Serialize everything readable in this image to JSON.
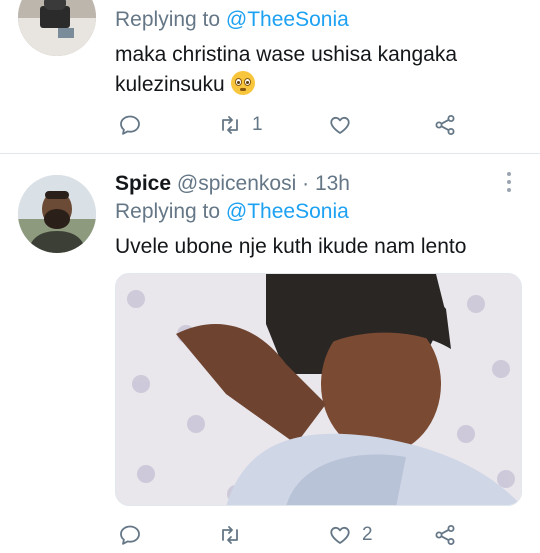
{
  "tweet1": {
    "replying_prefix": "Replying to",
    "replying_handle": "@TheeSonia",
    "text": "maka christina wase ushisa kangaka kulezinsuku",
    "emoji_icon": "flushed-face",
    "retweet_count": "1"
  },
  "tweet2": {
    "name": "Spice",
    "handle": "@spicenkosi",
    "separator": "·",
    "time": "13h",
    "replying_prefix": "Replying to",
    "replying_handle": "@TheeSonia",
    "text": "Uvele ubone nje kuth ikude nam lento",
    "like_count": "2"
  },
  "colors": {
    "link": "#1da1f2",
    "secondary_text": "#657786",
    "divider": "#e1e8ed"
  }
}
